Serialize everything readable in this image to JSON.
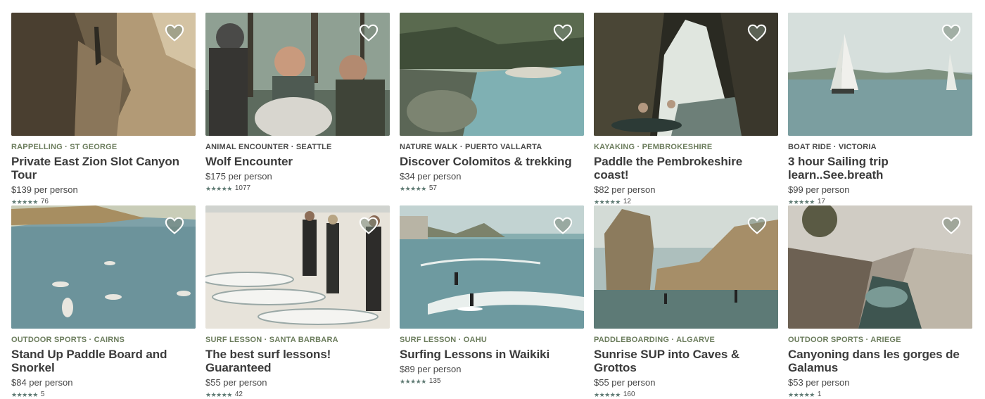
{
  "colors": {
    "category_sage": "#6b7c5c",
    "category_dark": "#484848",
    "star": "#5f7a73",
    "heart_fill": "rgba(120,135,120,0.55)"
  },
  "cards": [
    {
      "category": "RAPPELLING · ST GEORGE",
      "category_color": "#6b7c5c",
      "title": "Private East Zion Slot Canyon Tour",
      "price": "$139 per person",
      "stars": "★★★★★",
      "reviews": "76",
      "scene": "canyon-slot"
    },
    {
      "category": "ANIMAL ENCOUNTER · SEATTLE",
      "category_color": "#484848",
      "title": "Wolf Encounter",
      "price": "$175 per person",
      "stars": "★★★★★",
      "reviews": "1077",
      "scene": "forest-people"
    },
    {
      "category": "NATURE WALK · PUERTO VALLARTA",
      "category_color": "#484848",
      "title": "Discover Colomitos & trekking",
      "price": "$34 per person",
      "stars": "★★★★★",
      "reviews": "57",
      "scene": "cove"
    },
    {
      "category": "KAYAKING · PEMBROKESHIRE",
      "category_color": "#6b7c5c",
      "title": "Paddle the Pembrokeshire coast!",
      "price": "$82 per person",
      "stars": "★★★★★",
      "reviews": "12",
      "scene": "sea-cave"
    },
    {
      "category": "BOAT RIDE · VICTORIA",
      "category_color": "#484848",
      "title": "3 hour Sailing trip learn..See.breath",
      "price": "$99 per person",
      "stars": "★★★★★",
      "reviews": "17",
      "scene": "sailing"
    },
    {
      "category": "OUTDOOR SPORTS · CAIRNS",
      "category_color": "#6b7c5c",
      "title": "Stand Up Paddle Board and Snorkel",
      "price": "$84 per person",
      "stars": "★★★★★",
      "reviews": "5",
      "scene": "paddle-sea"
    },
    {
      "category": "SURF LESSON · SANTA BARBARA",
      "category_color": "#6b7c5c",
      "title": "The best surf lessons! Guaranteed",
      "price": "$55 per person",
      "stars": "★★★★★",
      "reviews": "42",
      "scene": "beach-boards"
    },
    {
      "category": "SURF LESSON · OAHU",
      "category_color": "#6b7c5c",
      "title": "Surfing Lessons in Waikiki",
      "price": "$89 per person",
      "stars": "★★★★★",
      "reviews": "135",
      "scene": "waikiki"
    },
    {
      "category": "PADDLEBOARDING · ALGARVE",
      "category_color": "#6b7c5c",
      "title": "Sunrise SUP into Caves & Grottos",
      "price": "$55 per person",
      "stars": "★★★★★",
      "reviews": "160",
      "scene": "cliffs"
    },
    {
      "category": "OUTDOOR SPORTS · ARIEGE",
      "category_color": "#6b7c5c",
      "title": "Canyoning dans les gorges de Galamus",
      "price": "$53 per person",
      "stars": "★★★★★",
      "reviews": "1",
      "scene": "gorge"
    }
  ]
}
